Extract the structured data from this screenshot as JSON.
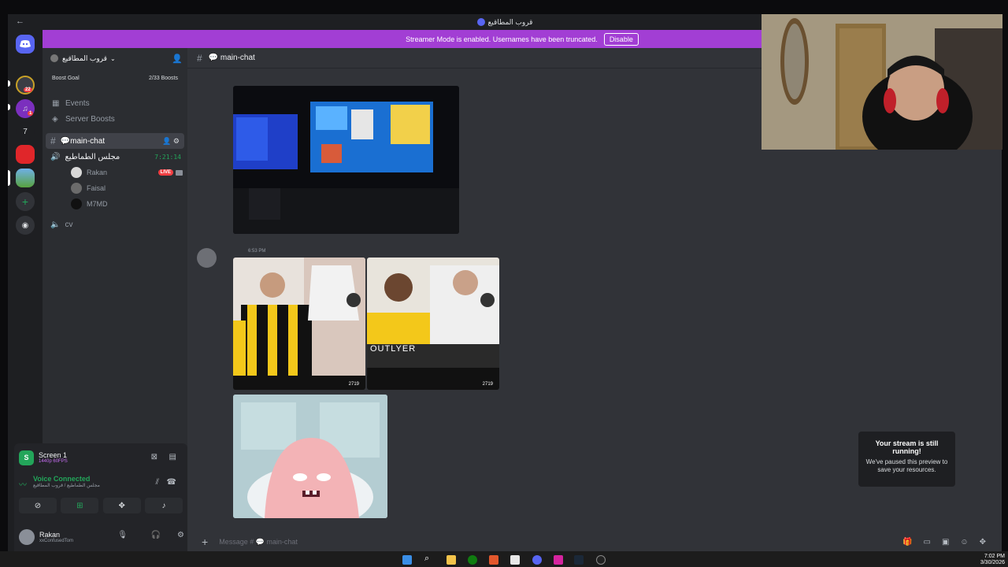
{
  "window": {
    "title": "قروب المطاقيع"
  },
  "banner": {
    "text": "Streamer Mode is enabled. Usernames have been truncated.",
    "button": "Disable"
  },
  "rail": {
    "badge1": "22",
    "badge2": "1",
    "server_seven": "7"
  },
  "guild": {
    "name": "قروب المطاقيع"
  },
  "boost": {
    "label": "Boost Goal",
    "progress": "2/33 Boosts"
  },
  "menu": {
    "events": "Events",
    "server_boosts": "Server Boosts"
  },
  "channels": {
    "main_chat": "💬main-chat",
    "voice": "مجلس الطماطيع",
    "voice_timer": "7:21:14",
    "cv": "cv"
  },
  "voice_users": [
    {
      "name": "Rakan",
      "live": "LIVE"
    },
    {
      "name": "Faisal"
    },
    {
      "name": "M7MD"
    }
  ],
  "stream": {
    "title": "Screen 1",
    "quality": "1440p 60FPS"
  },
  "voice_status": {
    "title": "Voice Connected",
    "location": "مجلس الطماطيع / قروب المطاقيع"
  },
  "user": {
    "name": "Rakan",
    "status": "xxConfusedTom"
  },
  "chat": {
    "header": "💬 main-chat",
    "msg_time": "6:53 PM",
    "tiktok_count_1": "2719",
    "tiktok_count_2": "2719",
    "placeholder": "Message # 💬 main-chat"
  },
  "toast": {
    "title": "Your stream is still running!",
    "body": "We've paused this preview to save your resources."
  },
  "taskbar": {
    "time": "7:02 PM",
    "date": "3/30/2026"
  }
}
